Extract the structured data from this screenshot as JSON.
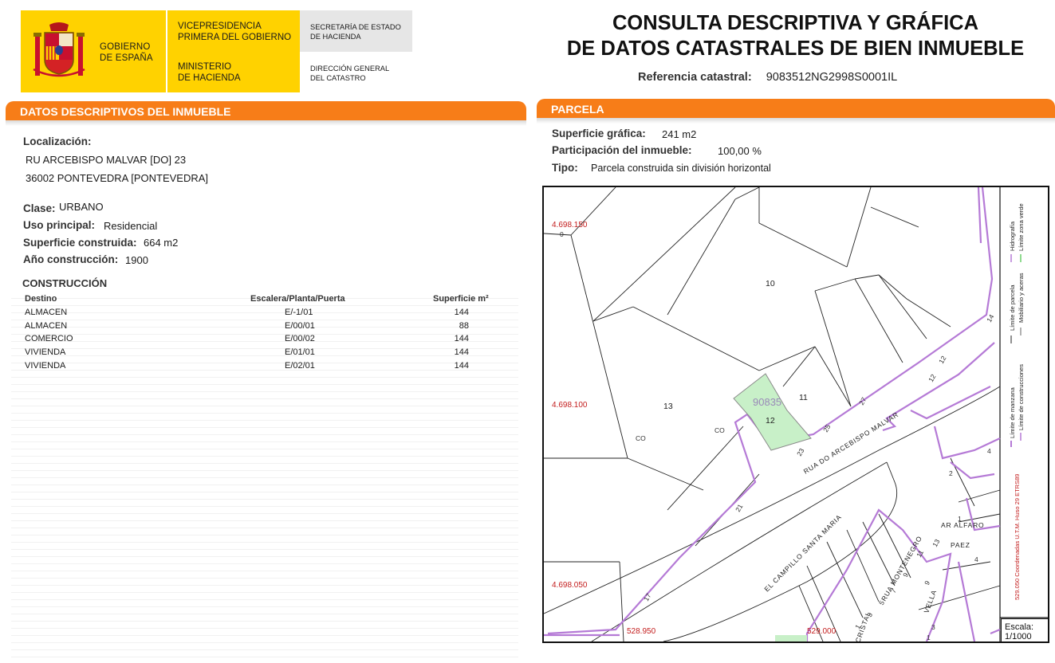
{
  "header": {
    "gov_name_line1": "GOBIERNO",
    "gov_name_line2": "DE ESPAÑA",
    "vice_line1": "VICEPRESIDENCIA",
    "vice_line2": "PRIMERA DEL GOBIERNO",
    "ministry_line1": "MINISTERIO",
    "ministry_line2": "DE HACIENDA",
    "secretaria_line1": "SECRETARÍA DE ESTADO",
    "secretaria_line2": "DE HACIENDA",
    "direccion_line1": "DIRECCIÓN GENERAL",
    "direccion_line2": "DEL CATASTRO",
    "title_line1": "CONSULTA DESCRIPTIVA Y GRÁFICA",
    "title_line2": "DE DATOS CATASTRALES DE BIEN INMUEBLE",
    "ref_label": "Referencia catastral:",
    "ref_value": "9083512NG2998S0001IL"
  },
  "descriptive": {
    "section_title": "DATOS DESCRIPTIVOS DEL INMUEBLE",
    "location_label": "Localización:",
    "address_line1": "RU ARCEBISPO MALVAR [DO] 23",
    "address_line2": "36002 PONTEVEDRA [PONTEVEDRA]",
    "clase_label": "Clase:",
    "clase_value": "URBANO",
    "uso_label": "Uso principal:",
    "uso_value": "Residencial",
    "superficie_label": "Superficie construida:",
    "superficie_value": "664 m2",
    "anio_label": "Año construcción:",
    "anio_value": "1900",
    "construccion_title": "CONSTRUCCIÓN",
    "table_headers": [
      "Destino",
      "Escalera/Planta/Puerta",
      "Superficie m²"
    ],
    "table_rows": [
      [
        "ALMACEN",
        "E/-1/01",
        "144"
      ],
      [
        "ALMACEN",
        "E/00/01",
        "88"
      ],
      [
        "COMERCIO",
        "E/00/02",
        "144"
      ],
      [
        "VIVIENDA",
        "E/01/01",
        "144"
      ],
      [
        "VIVIENDA",
        "E/02/01",
        "144"
      ]
    ]
  },
  "parcel": {
    "section_title": "PARCELA",
    "superficie_label": "Superficie gráfica:",
    "superficie_value": "241 m2",
    "participacion_label": "Participación del inmueble:",
    "participacion_value": "100,00 %",
    "tipo_label": "Tipo:",
    "tipo_value": "Parcela construida sin división horizontal"
  },
  "map": {
    "coord_y1": "4.698.150",
    "coord_y2": "4.698.100",
    "coord_y3": "4.698.050",
    "coord_x1": "528.950",
    "coord_x2": "529.000",
    "parcel_10": "10",
    "parcel_11": "11",
    "parcel_12": "12",
    "parcel_13": "13",
    "parcel_id": "90835",
    "co_label": "CO",
    "street_main": "RUA DO ARCEBISPO MALVAR",
    "street_campillo": "EL CAMPILLO SANTA MARIA",
    "street_alfaro": "AR ALFARO",
    "street_paez": "PAEZ",
    "street_montenegro": "RUA MONTENEGRO",
    "street_vella": "VELLA",
    "street_cristal": "CRISTAL",
    "utm_note": "529.050 Coordenadas U.T.M. Huso 29 ETRS89",
    "legend_manzana": "Límite de manzana",
    "legend_parcela": "Límite de parcela",
    "legend_hidrografia": "Hidrografía",
    "legend_construcciones": "Límite de construcciones",
    "legend_mobiliario": "Mobiliario y aceras",
    "legend_zona_verde": "Límite zona verde",
    "scale_label": "Escala:",
    "scale_value": "1/1000",
    "numbers": [
      "0",
      "14",
      "12",
      "12",
      "27",
      "25",
      "23",
      "21",
      "17",
      "2",
      "4",
      "1",
      "13",
      "11",
      "9",
      "7",
      "5",
      "3",
      "1",
      "9",
      "4",
      "3",
      "1"
    ]
  },
  "colors": {
    "orange": "#f77d18",
    "gov_yellow": "#ffd200",
    "purple": "#b57ad6",
    "parcel_green": "#c8f0c8",
    "coord_red": "#c31d1d"
  }
}
